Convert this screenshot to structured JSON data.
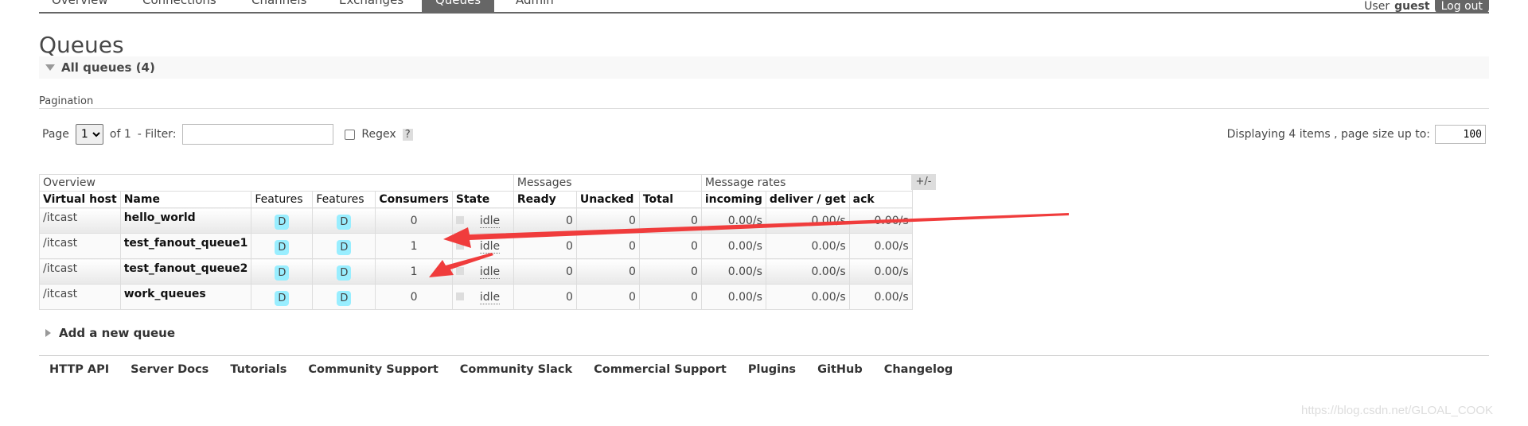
{
  "nav": {
    "tabs": [
      "Overview",
      "Connections",
      "Channels",
      "Exchanges",
      "Queues",
      "Admin"
    ],
    "active": "Queues",
    "user_label": "User",
    "user": "guest",
    "logout": "Log out"
  },
  "title": "Queues",
  "all_queues": "All queues (4)",
  "pagination": {
    "heading": "Pagination",
    "page_label": "Page",
    "page": "1",
    "of": "of 1",
    "filter_label": "- Filter:",
    "filter_value": "",
    "regex": "Regex",
    "help": "?",
    "displaying": "Displaying 4 items , page size up to:",
    "page_size": "100"
  },
  "table": {
    "groups": [
      "Overview",
      "Messages",
      "Message rates"
    ],
    "columns": [
      "Virtual host",
      "Name",
      "Features",
      "Features",
      "Consumers",
      "State",
      "Ready",
      "Unacked",
      "Total",
      "incoming",
      "deliver / get",
      "ack"
    ],
    "toggle": "+/-",
    "rows": [
      {
        "vhost": "/itcast",
        "name": "hello_world",
        "f1": "D",
        "f2": "D",
        "consumers": "0",
        "state": "idle",
        "ready": "0",
        "unacked": "0",
        "total": "0",
        "incoming": "0.00/s",
        "deliver": "0.00/s",
        "ack": "0.00/s"
      },
      {
        "vhost": "/itcast",
        "name": "test_fanout_queue1",
        "f1": "D",
        "f2": "D",
        "consumers": "1",
        "state": "idle",
        "ready": "0",
        "unacked": "0",
        "total": "0",
        "incoming": "0.00/s",
        "deliver": "0.00/s",
        "ack": "0.00/s"
      },
      {
        "vhost": "/itcast",
        "name": "test_fanout_queue2",
        "f1": "D",
        "f2": "D",
        "consumers": "1",
        "state": "idle",
        "ready": "0",
        "unacked": "0",
        "total": "0",
        "incoming": "0.00/s",
        "deliver": "0.00/s",
        "ack": "0.00/s"
      },
      {
        "vhost": "/itcast",
        "name": "work_queues",
        "f1": "D",
        "f2": "D",
        "consumers": "0",
        "state": "idle",
        "ready": "0",
        "unacked": "0",
        "total": "0",
        "incoming": "0.00/s",
        "deliver": "0.00/s",
        "ack": "0.00/s"
      }
    ]
  },
  "add_queue": "Add a new queue",
  "footer": [
    "HTTP API",
    "Server Docs",
    "Tutorials",
    "Community Support",
    "Community Slack",
    "Commercial Support",
    "Plugins",
    "GitHub",
    "Changelog"
  ],
  "watermark": "https://blog.csdn.net/GLOAL_COOK",
  "colors": {
    "annotation_arrow": "#f03c3c",
    "feature_badge": "#99eeff",
    "active_tab": "#666666"
  }
}
